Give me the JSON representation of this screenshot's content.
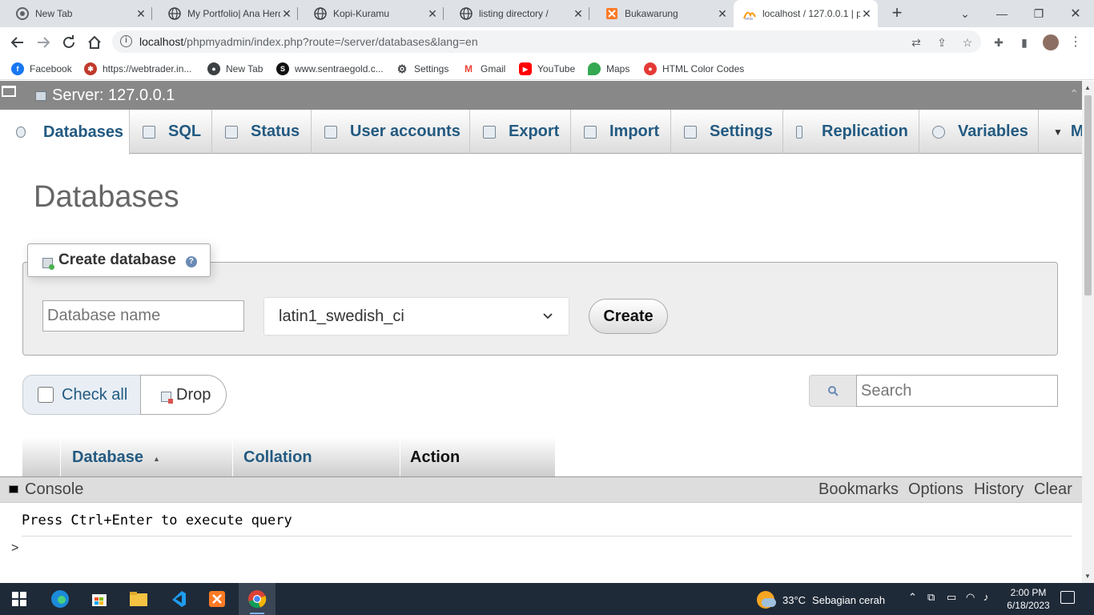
{
  "browser": {
    "tabs": [
      {
        "title": "New Tab",
        "favicon": "chrome-icon"
      },
      {
        "title": "My Portfolio| Ana Herd",
        "favicon": "globe-icon"
      },
      {
        "title": "Kopi-Kuramu",
        "favicon": "globe-icon"
      },
      {
        "title": "listing directory /",
        "favicon": "globe-icon"
      },
      {
        "title": "Bukawarung",
        "favicon": "xampp-icon"
      },
      {
        "title": "localhost / 127.0.0.1 | p",
        "favicon": "phpmyadmin-icon"
      }
    ],
    "url_host": "localhost",
    "url_path": "/phpmyadmin/index.php?route=/server/databases&lang=en",
    "bookmarks": [
      {
        "label": "Facebook",
        "icon": "facebook-icon",
        "color": "#1877f2"
      },
      {
        "label": "https://webtrader.in...",
        "icon": "webtrader-icon",
        "color": "#c0392b"
      },
      {
        "label": "New Tab",
        "icon": "chrome-icon",
        "color": "#3c4043"
      },
      {
        "label": "www.sentraegold.c...",
        "icon": "sentraegold-icon",
        "color": "#111111"
      },
      {
        "label": "Settings",
        "icon": "gear-icon",
        "color": "#3c4043"
      },
      {
        "label": "Gmail",
        "icon": "gmail-icon",
        "color": "#ea4335"
      },
      {
        "label": "YouTube",
        "icon": "youtube-icon",
        "color": "#ff0000"
      },
      {
        "label": "Maps",
        "icon": "maps-icon",
        "color": "#34a853"
      },
      {
        "label": "HTML Color Codes",
        "icon": "htmlcolor-icon",
        "color": "#e53935"
      }
    ]
  },
  "pma": {
    "server_title": "Server: 127.0.0.1",
    "menu": [
      {
        "label": "Databases",
        "icon": "database-icon"
      },
      {
        "label": "SQL",
        "icon": "sql-icon"
      },
      {
        "label": "Status",
        "icon": "status-icon"
      },
      {
        "label": "User accounts",
        "icon": "user-accounts-icon"
      },
      {
        "label": "Export",
        "icon": "export-icon"
      },
      {
        "label": "Import",
        "icon": "import-icon"
      },
      {
        "label": "Settings",
        "icon": "wrench-icon"
      },
      {
        "label": "Replication",
        "icon": "replication-icon"
      },
      {
        "label": "Variables",
        "icon": "variables-icon"
      }
    ],
    "more_label": "M",
    "page_title": "Databases",
    "create_db": {
      "legend": "Create database",
      "name_placeholder": "Database name",
      "collation_value": "latin1_swedish_ci",
      "create_label": "Create"
    },
    "check_all_label": "Check all",
    "drop_label": "Drop",
    "search_placeholder": "Search",
    "table_headers": {
      "database": "Database",
      "collation": "Collation",
      "action": "Action"
    },
    "console": {
      "title": "Console",
      "actions": [
        "Bookmarks",
        "Options",
        "History",
        "Clear"
      ],
      "hint": "Press Ctrl+Enter to execute query",
      "prompt": ">"
    }
  },
  "taskbar": {
    "weather_temp": "33°C",
    "weather_desc": "Sebagian cerah",
    "time": "2:00 PM",
    "date": "6/18/2023"
  }
}
